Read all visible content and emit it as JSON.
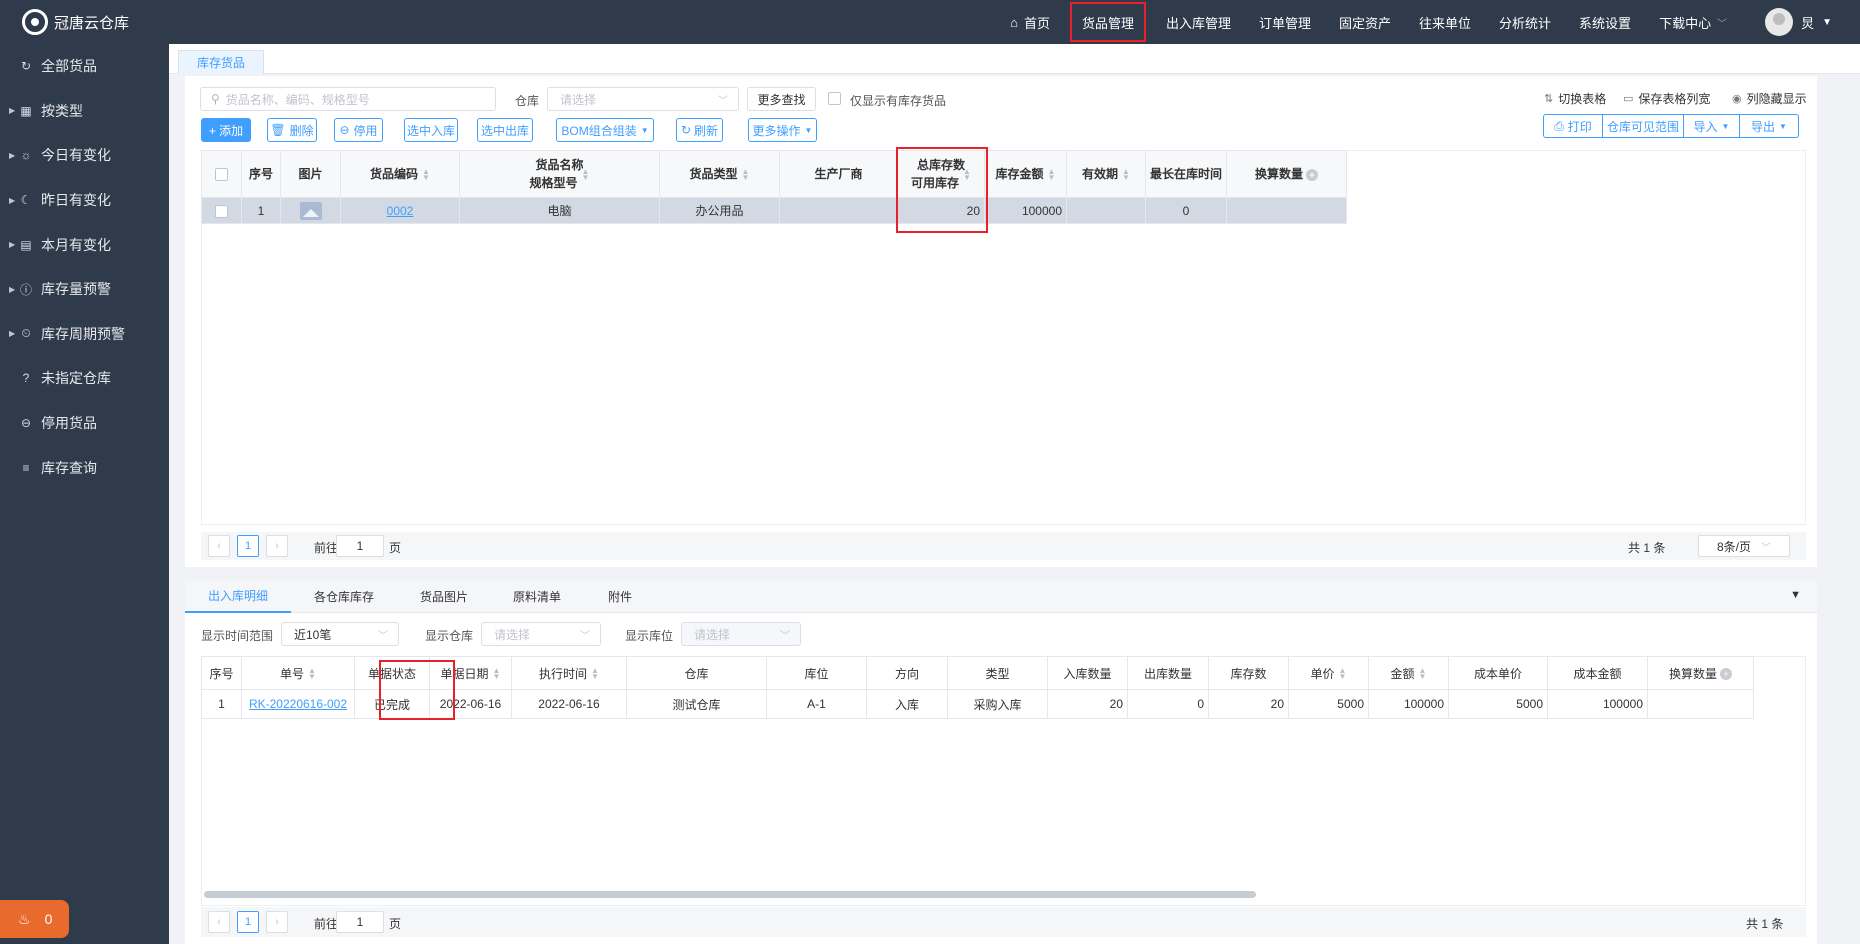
{
  "app": {
    "title": "冠唐云仓库"
  },
  "sidebar": {
    "items": [
      {
        "label": "全部货品",
        "icon": "refresh-icon",
        "caret": false
      },
      {
        "label": "按类型",
        "icon": "grid-icon",
        "caret": true
      },
      {
        "label": "今日有变化",
        "icon": "sun-icon",
        "caret": true
      },
      {
        "label": "昨日有变化",
        "icon": "moon-icon",
        "caret": true
      },
      {
        "label": "本月有变化",
        "icon": "calendar-icon",
        "caret": true
      },
      {
        "label": "库存量预警",
        "icon": "alert-circle-icon",
        "caret": true
      },
      {
        "label": "库存周期预警",
        "icon": "alarm-clock-icon",
        "caret": true
      },
      {
        "label": "未指定仓库",
        "icon": "question-icon",
        "caret": false
      },
      {
        "label": "停用货品",
        "icon": "minus-circle-icon",
        "caret": false
      },
      {
        "label": "库存查询",
        "icon": "list-icon",
        "caret": false
      }
    ],
    "alarm_count": "0"
  },
  "topnav": {
    "items": [
      "首页",
      "货品管理",
      "出入库管理",
      "订单管理",
      "固定资产",
      "往来单位",
      "分析统计",
      "系统设置",
      "下载中心"
    ],
    "active": "货品管理",
    "user": "炅"
  },
  "page_tab": "库存货品",
  "filters": {
    "search_placeholder": "货品名称、编码、规格型号",
    "warehouse_label": "仓库",
    "warehouse_placeholder": "请选择",
    "more_search": "更多查找",
    "only_stock_label": "仅显示有库存货品"
  },
  "top_actions": [
    "切换表格",
    "保存表格列宽",
    "列隐藏显示"
  ],
  "toolbar": {
    "add": "+ 添加",
    "delete": "删除",
    "disable": "停用",
    "selected_in": "选中入库",
    "selected_out": "选中出库",
    "bom": "BOM组合组装",
    "refresh": "刷新",
    "more_ops": "更多操作"
  },
  "right_group": [
    "打印",
    "仓库可见范围",
    "导入",
    "导出"
  ],
  "inventory_table": {
    "headers": {
      "seq": "序号",
      "image": "图片",
      "code": "货品编码",
      "name_line1": "货品名称",
      "name_line2": "规格型号",
      "type": "货品类型",
      "maker": "生产厂商",
      "stock_line1": "总库存数",
      "stock_line2": "可用库存",
      "amount": "库存金额",
      "expiry": "有效期",
      "longest": "最长在库时间",
      "converted": "换算数量"
    },
    "rows": [
      {
        "seq": "1",
        "code": "0002",
        "name": "电脑",
        "type": "办公用品",
        "maker": "",
        "stock": "20",
        "amount": "100000",
        "expiry": "",
        "longest": "0",
        "converted": ""
      }
    ]
  },
  "pager": {
    "current": "1",
    "goto_label": "前往",
    "page_label": "页",
    "goto_value": "1",
    "total": "共 1 条",
    "page_size": "8条/页"
  },
  "detail_tabs": [
    "出入库明细",
    "各仓库库存",
    "货品图片",
    "原料清单",
    "附件"
  ],
  "detail_filters": {
    "range_label": "显示时间范围",
    "range_value": "近10笔",
    "warehouse_label": "显示仓库",
    "warehouse_placeholder": "请选择",
    "location_label": "显示库位",
    "location_placeholder": "请选择"
  },
  "tx_table": {
    "headers": [
      "序号",
      "单号",
      "单据状态",
      "单据日期",
      "执行时间",
      "仓库",
      "库位",
      "方向",
      "类型",
      "入库数量",
      "出库数量",
      "库存数",
      "单价",
      "金额",
      "成本单价",
      "成本金额",
      "换算数量"
    ],
    "rows": [
      {
        "seq": "1",
        "no": "RK-20220616-002",
        "status": "已完成",
        "date": "2022-06-16",
        "exec": "2022-06-16",
        "warehouse": "测试仓库",
        "location": "A-1",
        "direction": "入库",
        "type": "采购入库",
        "in_qty": "20",
        "out_qty": "0",
        "stock": "20",
        "price": "5000",
        "amount": "100000",
        "cost_price": "5000",
        "cost_amount": "100000",
        "converted": ""
      }
    ]
  },
  "lower_pager": {
    "current": "1",
    "goto_label": "前往",
    "page_label": "页",
    "goto_value": "1",
    "total": "共 1 条"
  },
  "colors": {
    "sidebar_bg": "#2f3a4a",
    "accent": "#409eff",
    "highlight": "#e8202a",
    "alarm": "#e86a2c"
  }
}
